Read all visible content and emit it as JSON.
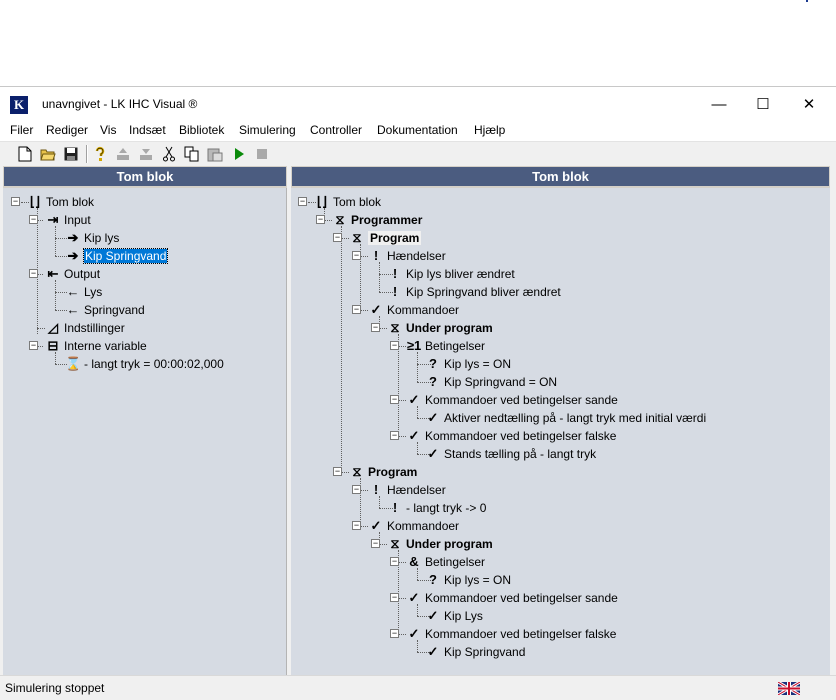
{
  "window": {
    "title": "unavngivet - LK IHC Visual ®",
    "app_icon": "K",
    "controls": {
      "minimize": "—",
      "maximize": "☐",
      "close": "✕"
    }
  },
  "menu": [
    "Filer",
    "Rediger",
    "Vis",
    "Indsæt",
    "Bibliotek",
    "Simulering",
    "Controller",
    "Dokumentation",
    "Hjælp"
  ],
  "toolbar": [
    "new-file-icon",
    "open-folder-icon",
    "save-icon",
    "help-icon",
    "upload-icon",
    "download-icon",
    "cut-icon",
    "copy-icon",
    "paste-icon",
    "run-icon",
    "stop-icon"
  ],
  "left_panel": {
    "header": "Tom blok",
    "items": [
      {
        "label": "Tom blok",
        "icon": "block-icon"
      },
      {
        "label": "Input",
        "icon": "input-icon"
      },
      {
        "label": "Kip lys",
        "icon": "arrow-right-icon"
      },
      {
        "label": "Kip Springvand",
        "icon": "arrow-right-icon",
        "selected": true
      },
      {
        "label": "Output",
        "icon": "output-icon"
      },
      {
        "label": "Lys",
        "icon": "arrow-left-icon"
      },
      {
        "label": "Springvand",
        "icon": "arrow-left-icon"
      },
      {
        "label": "Indstillinger",
        "icon": "settings-icon"
      },
      {
        "label": "Interne variable",
        "icon": "variable-icon"
      },
      {
        "label": "- langt tryk = 00:00:02,000",
        "icon": "hourglass-icon"
      }
    ]
  },
  "right_panel": {
    "header": "Tom blok",
    "items": [
      {
        "label": "Tom blok",
        "icon": "block-icon"
      },
      {
        "label": "Programmer",
        "icon": "program-icon"
      },
      {
        "label": "Program",
        "icon": "program-icon"
      },
      {
        "label": "Hændelser",
        "icon": "event-icon"
      },
      {
        "label": "Kip lys bliver ændret",
        "icon": "event-icon"
      },
      {
        "label": "Kip Springvand bliver ændret",
        "icon": "event-icon"
      },
      {
        "label": "Kommandoer",
        "icon": "check-icon"
      },
      {
        "label": "Under program",
        "icon": "program-icon"
      },
      {
        "label": "Betingelser",
        "icon": "or-condition-icon"
      },
      {
        "label": "Kip lys = ON",
        "icon": "question-icon"
      },
      {
        "label": "Kip Springvand = ON",
        "icon": "question-icon"
      },
      {
        "label": "Kommandoer ved betingelser sande",
        "icon": "check-icon"
      },
      {
        "label": "Aktiver nedtælling på - langt tryk med initial værdi",
        "icon": "check-icon"
      },
      {
        "label": "Kommandoer ved betingelser falske",
        "icon": "check-icon"
      },
      {
        "label": "Stands tælling på - langt tryk",
        "icon": "check-icon"
      },
      {
        "label": "Program",
        "icon": "program-icon"
      },
      {
        "label": "Hændelser",
        "icon": "event-icon"
      },
      {
        "label": "- langt tryk -> 0",
        "icon": "event-icon"
      },
      {
        "label": "Kommandoer",
        "icon": "check-icon"
      },
      {
        "label": "Under program",
        "icon": "program-icon"
      },
      {
        "label": "Betingelser",
        "icon": "and-condition-icon"
      },
      {
        "label": "Kip lys = ON",
        "icon": "question-icon"
      },
      {
        "label": "Kommandoer ved betingelser sande",
        "icon": "check-icon"
      },
      {
        "label": "Kip Lys",
        "icon": "check-icon"
      },
      {
        "label": "Kommandoer ved betingelser falske",
        "icon": "check-icon"
      },
      {
        "label": "Kip Springvand",
        "icon": "check-icon"
      }
    ]
  },
  "status": {
    "text": "Simulering stoppet",
    "language_flag": "uk-flag-icon"
  }
}
